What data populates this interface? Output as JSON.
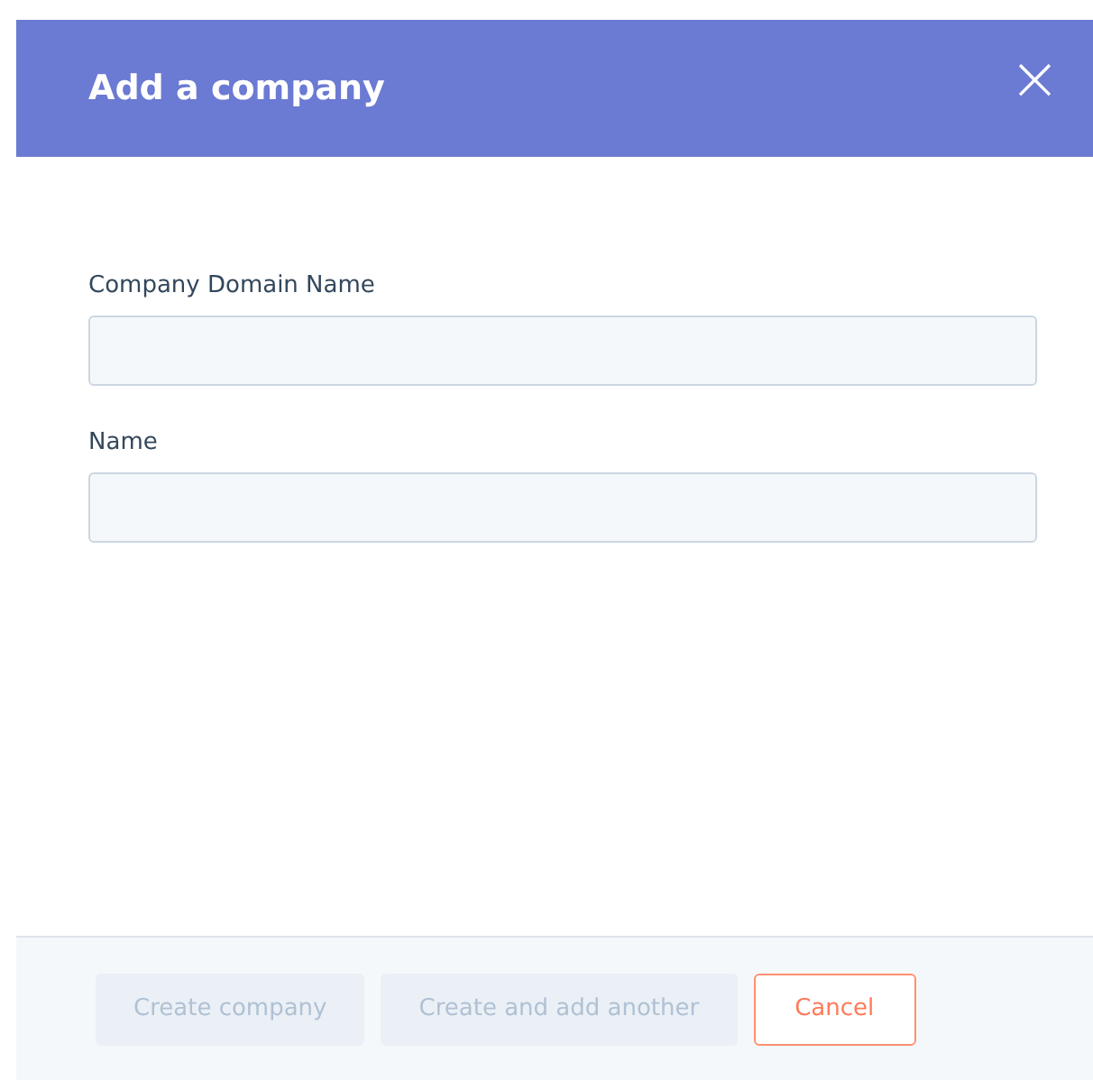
{
  "dialog": {
    "title": "Add a company",
    "close": "×"
  },
  "fields": [
    {
      "label": "Company Domain Name"
    },
    {
      "label": "Name"
    }
  ],
  "buttons": [
    {
      "label": "Create company",
      "disabled": true
    },
    {
      "label": "Create and add another",
      "disabled": true
    },
    {
      "label": "Cancel",
      "disabled": false
    }
  ]
}
